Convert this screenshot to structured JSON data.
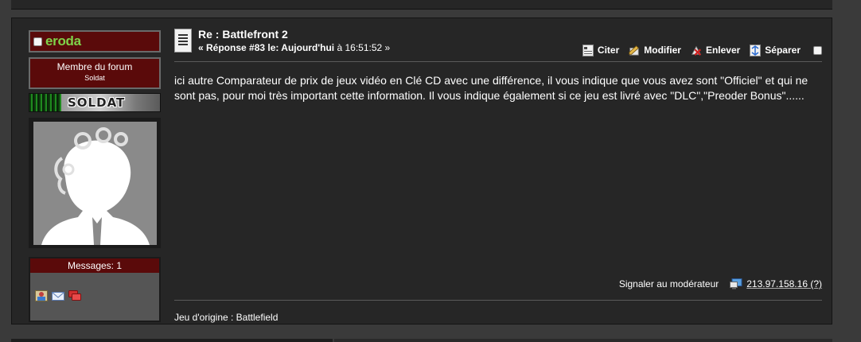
{
  "poster": {
    "username": "eroda",
    "name_color": "#7fd24a",
    "group_title": "Membre du forum",
    "rank": "Soldat",
    "rank_image_text": "SOLDAT",
    "messages_label": "Messages: 1",
    "contact_icons": [
      "profile-icon",
      "email-icon",
      "pm-icon"
    ]
  },
  "post": {
    "title": "Re : Battlefront 2",
    "meta_prefix": "« Réponse #83 le: ",
    "meta_day": "Aujourd'hui",
    "meta_time_prefix": " à 16:51:52 »",
    "body": "ici autre Comparateur de prix de jeux vidéo en Clé CD avec une différence, il vous indique que vous avez sont \"Officiel\" et qui ne sont pas, pour moi très important cette information. Il vous indique également si ce jeu est livré avec \"DLC\",\"Preoder Bonus\"......",
    "report_label": "Signaler au modérateur",
    "ip": "213.97.158.16 (?)",
    "signature": "Jeu d'origine : Battlefield"
  },
  "actions": {
    "quote": "Citer",
    "modify": "Modifier",
    "remove": "Enlever",
    "split": "Séparer"
  },
  "colors": {
    "background": "#3a3a3a",
    "post_bg": "#262626",
    "dark_red": "#5a0a0a"
  }
}
